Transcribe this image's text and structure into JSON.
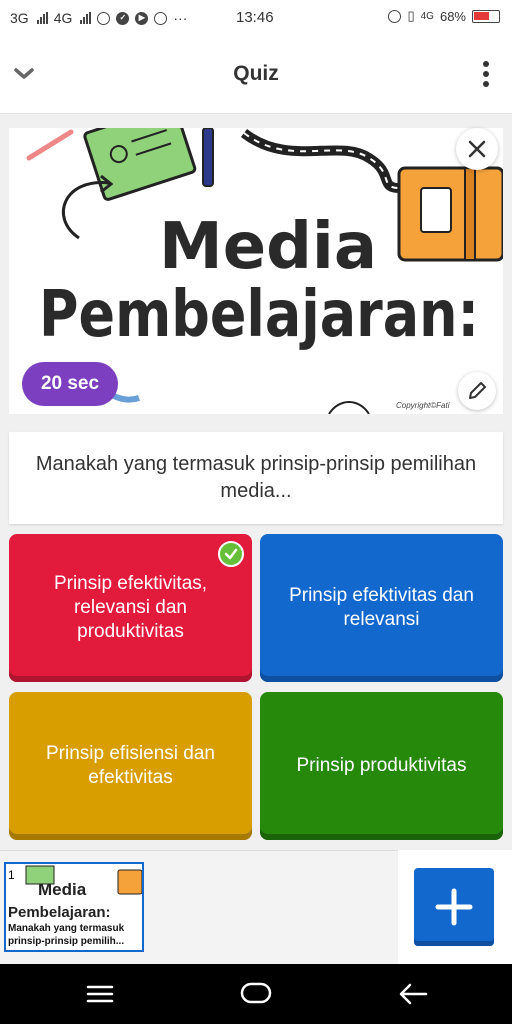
{
  "status_bar": {
    "net1": "3G",
    "net2": "4G",
    "clock": "13:46",
    "net_right": "4G",
    "battery": "68%"
  },
  "app_bar": {
    "title": "Quiz"
  },
  "media": {
    "title_line1": "Media",
    "title_line2": "Pembelajaran:",
    "timer": "20 sec",
    "copyright": "Copyright©Fati"
  },
  "question": {
    "text": "Manakah yang termasuk prinsip-prinsip pemilihan media..."
  },
  "answers": [
    {
      "label": "Prinsip efektivitas, relevansi dan produktivitas",
      "color": "#e21b3c",
      "correct": true
    },
    {
      "label": "Prinsip efektivitas dan relevansi",
      "color": "#1368ce",
      "correct": false
    },
    {
      "label": "Prinsip efisiensi dan efektivitas",
      "color": "#d89e00",
      "correct": false
    },
    {
      "label": "Prinsip produktivitas",
      "color": "#26890c",
      "correct": false
    }
  ],
  "slide_tray": {
    "slides": [
      {
        "number": "1",
        "thumb_title1": "Media",
        "thumb_title2": "Pembelajaran:",
        "question": "Manakah yang termasuk prinsip-prinsip pemilih..."
      }
    ]
  },
  "icons": {
    "collapse": "chevron-down-icon",
    "more": "more-vertical-icon",
    "close": "close-icon",
    "edit": "pencil-icon",
    "correct": "check-icon",
    "add": "plus-icon"
  }
}
